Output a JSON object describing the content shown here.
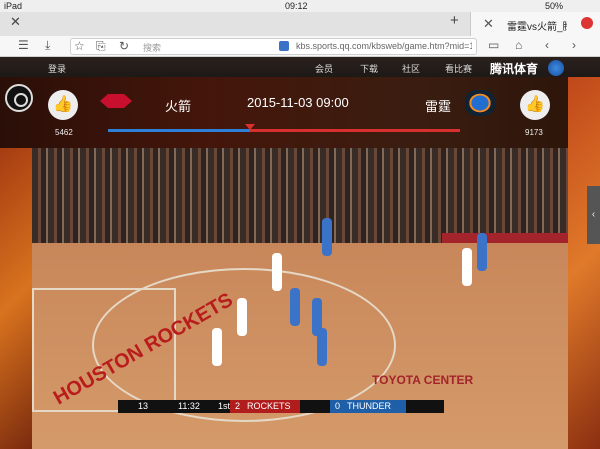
{
  "status": {
    "left": "iPad",
    "time": "09:12",
    "battery": "50%"
  },
  "tab": {
    "title": "雷霆vs火箭_腾讯体育"
  },
  "url": {
    "search_placeholder": "搜索",
    "address": "kbs.sports.qq.com/kbsweb/game.htm?mid=1..."
  },
  "nav": {
    "items": [
      "登录",
      "会员",
      "下载",
      "社区",
      "看比赛"
    ],
    "logo": "腾讯体育"
  },
  "match": {
    "team_left": "火箭",
    "team_right": "雷霆",
    "time": "2015-11-03 09:00",
    "likes_left": "5462",
    "likes_right": "9173",
    "vote_share_left": 0.4
  },
  "scoreboard": {
    "team1": "THUNDER",
    "score1": "0",
    "team2": "ROCKETS",
    "score2": "2",
    "period": "1st",
    "clock": "11:32",
    "shot_clock": "13"
  },
  "court": {
    "text": "HOUSTON ROCKETS",
    "ad": "TOYOTA CENTER"
  },
  "colors": {
    "accent_red": "#d8302e",
    "accent_blue": "#2d7fd8"
  }
}
